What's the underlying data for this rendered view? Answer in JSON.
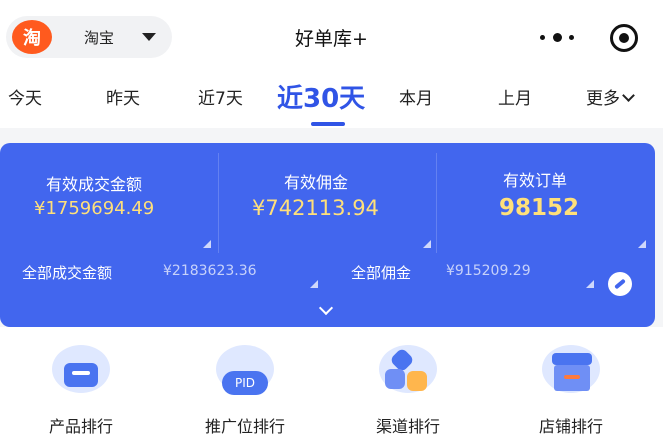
{
  "header": {
    "platform_logo_text": "淘",
    "platform_name": "淘宝",
    "title": "好单库+"
  },
  "tabs": [
    {
      "label": "今天",
      "active": false
    },
    {
      "label": "昨天",
      "active": false
    },
    {
      "label": "近7天",
      "active": false
    },
    {
      "label": "近30天",
      "active": true
    },
    {
      "label": "本月",
      "active": false
    },
    {
      "label": "上月",
      "active": false
    },
    {
      "label": "更多",
      "active": false
    }
  ],
  "stats": {
    "valid_gmv": {
      "label": "有效成交金额",
      "value": "¥1759694.49"
    },
    "valid_commission": {
      "label": "有效佣金",
      "value": "¥742113.94"
    },
    "valid_orders": {
      "label": "有效订单",
      "value": "98152"
    },
    "total_gmv": {
      "label": "全部成交金额",
      "value": "¥2183623.36"
    },
    "total_commission": {
      "label": "全部佣金",
      "value": "¥915209.29"
    }
  },
  "rankings": [
    {
      "label": "产品排行",
      "icon": "product-rank-icon"
    },
    {
      "label": "推广位排行",
      "icon": "pid-rank-icon",
      "badge": "PID"
    },
    {
      "label": "渠道排行",
      "icon": "channel-rank-icon"
    },
    {
      "label": "店铺排行",
      "icon": "shop-rank-icon"
    }
  ],
  "colors": {
    "accent": "#3054e6",
    "card_bg": "#4266ee",
    "value_yellow": "#ffe07a",
    "taobao_orange": "#ff5a1e"
  }
}
